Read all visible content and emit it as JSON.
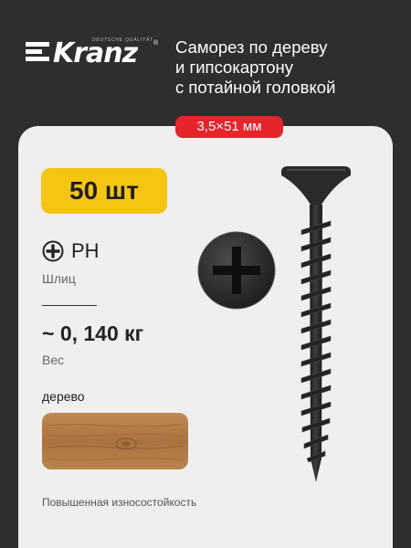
{
  "brand": {
    "name": "Kranz",
    "tagline": "DEUTSCHE QUALITÄT",
    "registered": "®"
  },
  "product": {
    "title_lines": [
      "Саморез по дереву",
      "и гипсокартону",
      "с потайной головкой"
    ],
    "size": "3,5×51 мм",
    "quantity": "50 шт",
    "slot_type": "PH",
    "slot_label": "Шлиц",
    "weight": "~ 0, 140 кг",
    "weight_label": "Вес",
    "material": "дерево",
    "feature": "Повышенная износостойкость"
  },
  "icons": {
    "slot": "phillips-icon",
    "head": "phillips-head-icon",
    "screw": "screw-illustration",
    "wood": "wood-texture-swatch"
  },
  "colors": {
    "background": "#2e2e2e",
    "panel": "#efefef",
    "size_badge": "#e5242b",
    "quantity_badge": "#f6c514",
    "wood": "#b07a44"
  }
}
